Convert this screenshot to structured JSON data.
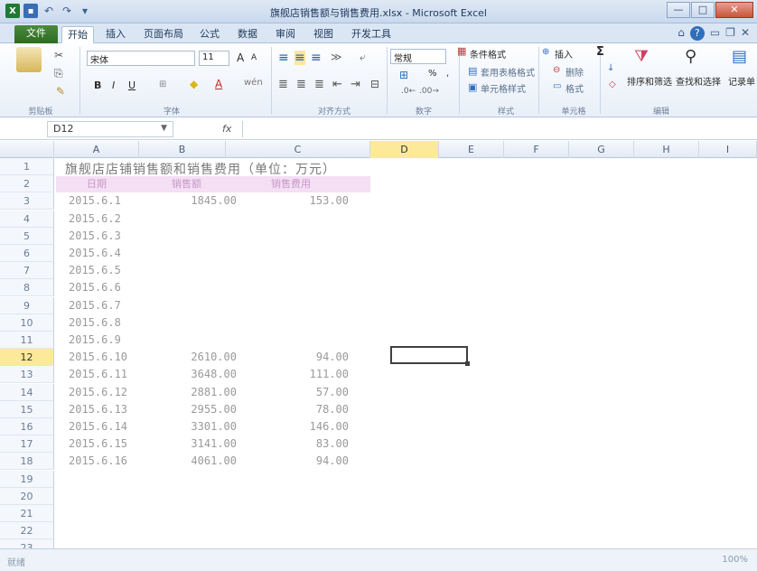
{
  "window": {
    "title": "旗舰店销售额与销售费用.xlsx - Microsoft Excel",
    "controls": {
      "minimize": "—",
      "maximize": "□",
      "close": "✕"
    }
  },
  "qat": {
    "app_icon": "X",
    "save_icon": "💾",
    "undo_icon": "↶",
    "redo_icon": "↷",
    "customize_icon": "▾"
  },
  "tabs": {
    "file": "文件",
    "items": [
      "开始",
      "插入",
      "页面布局",
      "公式",
      "数据",
      "审阅",
      "视图",
      "开发工具"
    ],
    "active": "开始",
    "right_icons": {
      "expand": "⌂",
      "help": "?",
      "min": "▭",
      "restore": "❐",
      "close": "✕"
    }
  },
  "ribbon": {
    "font_name": "宋体",
    "font_size": "11",
    "grow_font": "A",
    "shrink_font": "A",
    "bold": "B",
    "italic": "I",
    "underline": "U",
    "number_format": "常规",
    "percent": "%",
    "comma": ",",
    "conditional_format": "条件格式",
    "table_format": "套用表格格式",
    "cell_style": "单元格样式",
    "insert": "插入",
    "delete": "删除",
    "format": "格式",
    "sum": "Σ",
    "sort_filter": "排序和筛选",
    "find_select": "查找和选择",
    "record": "记录单",
    "groups": [
      "剪贴板",
      "字体",
      "对齐方式",
      "数字",
      "样式",
      "单元格",
      "编辑"
    ]
  },
  "formula_bar": {
    "name_box": "D12",
    "fx": "fx",
    "content": ""
  },
  "columns": [
    "A",
    "B",
    "C",
    "D",
    "E",
    "F",
    "G",
    "H",
    "I"
  ],
  "selected_column": "D",
  "rows": [
    "1",
    "2",
    "3",
    "4",
    "5",
    "6",
    "7",
    "8",
    "9",
    "10",
    "11",
    "12",
    "13",
    "14",
    "15",
    "16",
    "17",
    "18",
    "19",
    "20",
    "21",
    "22",
    "23"
  ],
  "selected_row": "12",
  "sheet": {
    "title": "旗舰店店铺销售额和销售费用（单位：万元）",
    "headers": [
      "日期",
      "销售额",
      "销售费用"
    ],
    "data": [
      [
        "2015.6.1",
        "1845.00",
        "153.00"
      ],
      [
        "2015.6.2",
        "",
        ""
      ],
      [
        "2015.6.3",
        "",
        ""
      ],
      [
        "2015.6.4",
        "",
        ""
      ],
      [
        "2015.6.5",
        "",
        ""
      ],
      [
        "2015.6.6",
        "",
        ""
      ],
      [
        "2015.6.7",
        "",
        ""
      ],
      [
        "2015.6.8",
        "",
        ""
      ],
      [
        "2015.6.9",
        "",
        ""
      ],
      [
        "2015.6.10",
        "2610.00",
        "94.00"
      ],
      [
        "2015.6.11",
        "3648.00",
        "111.00"
      ],
      [
        "2015.6.12",
        "2881.00",
        "57.00"
      ],
      [
        "2015.6.13",
        "2955.00",
        "78.00"
      ],
      [
        "2015.6.14",
        "3301.00",
        "146.00"
      ],
      [
        "2015.6.15",
        "3141.00",
        "83.00"
      ],
      [
        "2015.6.16",
        "4061.00",
        "94.00"
      ]
    ]
  },
  "status": {
    "left": "就绪",
    "zoom": "100%"
  }
}
